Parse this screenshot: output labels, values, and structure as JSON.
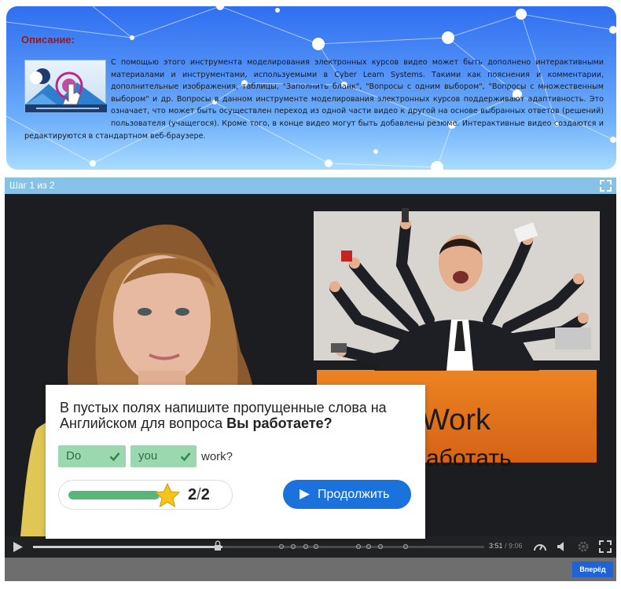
{
  "description": {
    "title": "Описание:",
    "text": "С помощью этого инструмента моделирования электронных курсов видео может быть дополнено интерактивными материалами и инструментами, используемыми в Cyber Learn Systems. Такими как пояснения и комментарии, дополнительные изображения, таблицы, \"Заполнить бланк\", \"Вопросы с одним выбором\", \"Вопросы с множественным выбором\" и др. Вопросы в данном инструменте моделирования электронных курсов поддерживают адаптивность. Это означает, что может быть осуществлен переход из одной части видео к другой на основе выбранных ответов (решений) пользователя (учащегося). Кроме того, в конце видео могут быть добавлены резюме. Интерактивные видео создаются и редактируются в стандартном веб-браузере."
  },
  "player": {
    "step_label": "Шаг 1 из 2",
    "slide": {
      "word_en": "Work",
      "word_ru": "аботать"
    }
  },
  "question": {
    "text_prefix": "В пустых полях напишите пропущенные слова на Английском для вопроса ",
    "text_bold": "Вы работаете?",
    "answers": [
      "Do",
      "you"
    ],
    "trailing_word": "work?",
    "score_current": "2",
    "score_sep": "/",
    "score_total": "2",
    "progress_fraction": 1.0,
    "continue_label": "Продолжить"
  },
  "controls": {
    "time_current": "3:51",
    "time_sep": " / ",
    "time_total": "9:06",
    "played_fraction": 0.42
  },
  "footer": {
    "next_label": "Вперёд"
  },
  "colors": {
    "accent_blue": "#1b72dd",
    "answer_green": "#9bd8b0",
    "progress_green": "#57b77a",
    "title_red": "#9c1616",
    "step_bar": "#87c2e6"
  },
  "icons": [
    "interactive-video-thumbnail",
    "expand-icon",
    "check-icon",
    "star-icon",
    "play-icon",
    "speed-gauge-icon",
    "volume-icon",
    "settings-icon",
    "fullscreen-icon"
  ]
}
